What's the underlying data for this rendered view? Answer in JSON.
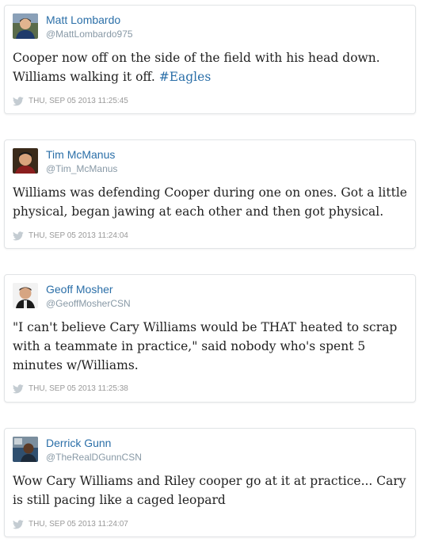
{
  "colors": {
    "link": "#2b6fa8",
    "handle": "#8899a6",
    "meta": "#999999",
    "text": "#222222",
    "border": "#e1e4e6",
    "bird_icon": "#c4ccd2"
  },
  "tweets": [
    {
      "author_name": "Matt Lombardo",
      "handle": "@MattLombardo975",
      "text_before": "Cooper now off on the side of the field with his head down. Williams walking it off. ",
      "hashtag": "#Eagles",
      "timestamp": "THU, SEP 05 2013 11:25:45",
      "avatar_icon": "person-avatar-icon"
    },
    {
      "author_name": "Tim McManus",
      "handle": "@Tim_McManus",
      "text": "Williams was defending Cooper during one on ones. Got a little physical, began jawing at each other and then got physical.",
      "timestamp": "THU, SEP 05 2013 11:24:04",
      "avatar_icon": "person-avatar-icon"
    },
    {
      "author_name": "Geoff Mosher",
      "handle": "@GeoffMosherCSN",
      "text": "\"I can't believe Cary Williams would be THAT heated to scrap with a teammate in practice,\" said nobody who's spent 5 minutes w/Williams.",
      "timestamp": "THU, SEP 05 2013 11:25:38",
      "avatar_icon": "person-avatar-icon"
    },
    {
      "author_name": "Derrick Gunn",
      "handle": "@TheRealDGunnCSN",
      "text": "Wow Cary Williams and Riley cooper go at it at practice... Cary is still pacing like a caged leopard",
      "timestamp": "THU, SEP 05 2013 11:24:07",
      "avatar_icon": "person-avatar-icon"
    }
  ]
}
